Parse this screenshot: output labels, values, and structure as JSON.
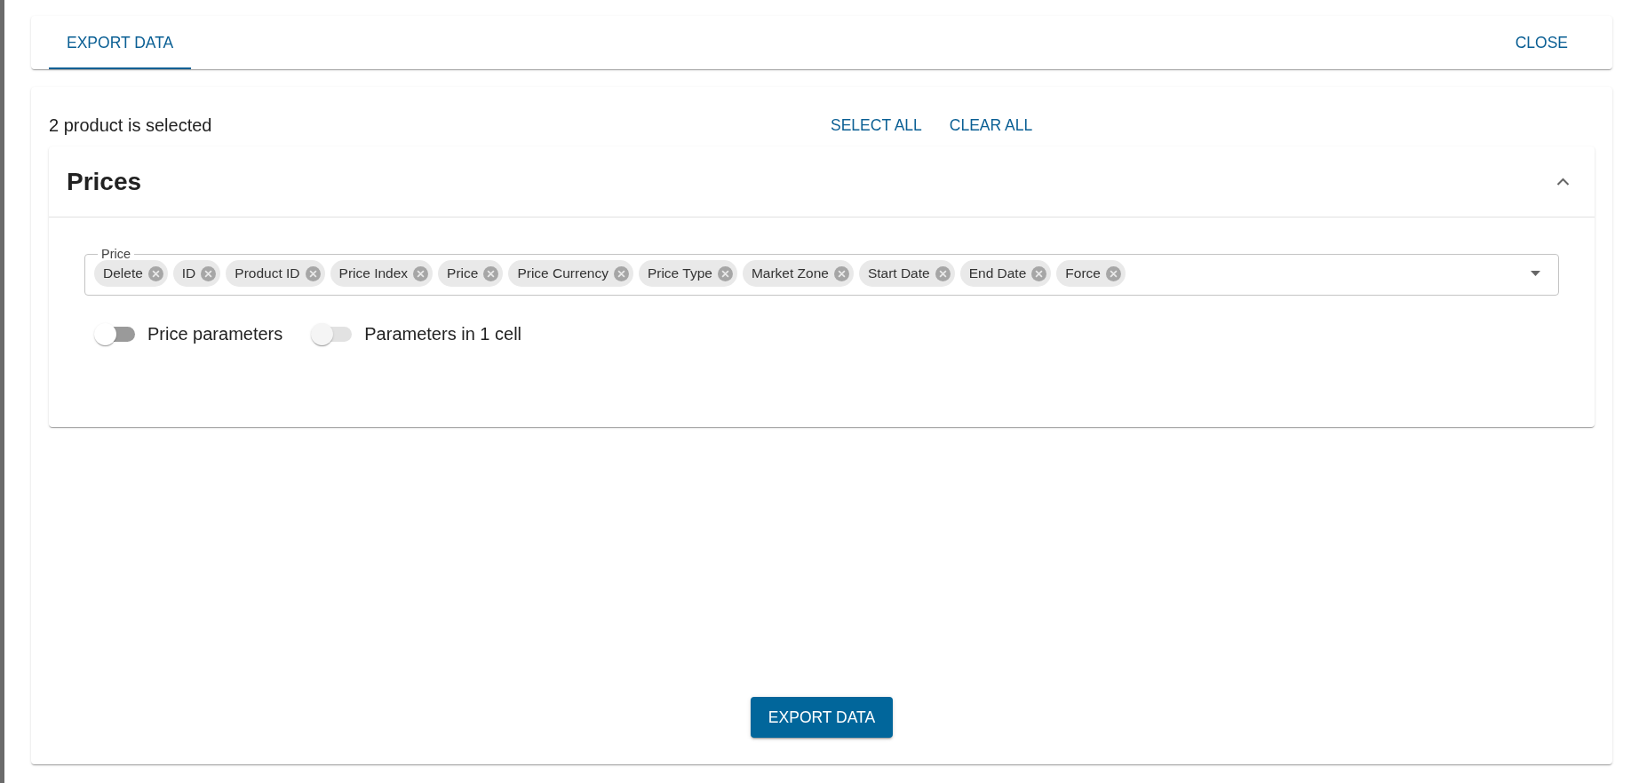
{
  "tabs": [
    {
      "label": "EXPORT DATA",
      "selected": true
    }
  ],
  "close_button": "CLOSE",
  "selection_summary": "2 product is selected",
  "select_all_button": "SELECT ALL",
  "clear_all_button": "CLEAR ALL",
  "section": {
    "title": "Prices",
    "expanded": true,
    "field": {
      "label": "Price",
      "chips": [
        "Delete",
        "ID",
        "Product ID",
        "Price Index",
        "Price",
        "Price Currency",
        "Price Type",
        "Market Zone",
        "Start Date",
        "End Date",
        "Force"
      ]
    },
    "switches": [
      {
        "label": "Price parameters",
        "checked": false,
        "disabled": false
      },
      {
        "label": "Parameters in 1 cell",
        "checked": false,
        "disabled": true
      }
    ]
  },
  "export_button": "EXPORT DATA"
}
